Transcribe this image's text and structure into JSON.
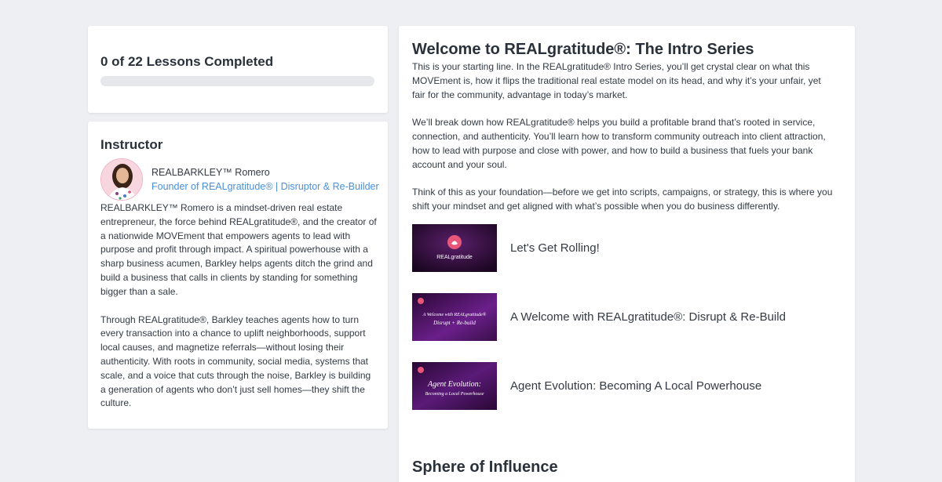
{
  "progress": {
    "label": "0 of 22 Lessons Completed",
    "completed": 0,
    "total": 22
  },
  "instructor": {
    "heading": "Instructor",
    "name": "REALBARKLEY™ Romero",
    "role": "Founder of REALgratitude® | Disruptor & Re-Builder",
    "bio": [
      "REALBARKLEY™ Romero is a mindset-driven real estate entrepreneur, the force behind REALgratitude®, and the creator of a nationwide MOVEment that empowers agents to lead with purpose and profit through impact. A spiritual powerhouse with a sharp business acumen, Barkley helps agents ditch the grind and build a business that calls in clients by standing for something bigger than a sale.",
      "Through REALgratitude®, Barkley teaches agents how to turn every transaction into a chance to uplift neighborhoods, support local causes, and magnetize referrals—without losing their authenticity. With roots in community, social media, systems that scale, and a voice that cuts through the noise, Barkley is building a generation of agents who don’t just sell homes—they shift the culture."
    ]
  },
  "course": {
    "title": "Welcome to REALgratitude®: The Intro Series",
    "paragraphs": [
      "This is your starting line. In the REALgratitude® Intro Series, you’ll get crystal clear on what this MOVEment is, how it flips the traditional real estate model on its head, and why it’s your unfair, yet fair for the community, advantage in today’s market.",
      "We’ll break down how REALgratitude® helps you build a profitable brand that’s rooted in service, connection, and authenticity. You’ll learn how to transform community outreach into client attraction, how to lead with purpose and close with power, and how to build a business that fuels your bank account and your soul.",
      "Think of this as your foundation—before we get into scripts, campaigns, or strategy, this is where you shift your mindset and get aligned with what’s possible when you do business differently."
    ],
    "lessons": [
      {
        "title": "Let's Get Rolling!",
        "thumb_text": "REALgratitude",
        "thumb_text_sub": ""
      },
      {
        "title": "A Welcome with REALgratitude®: Disrupt & Re-Build",
        "thumb_text": "A Welcome with REALgratitude®",
        "thumb_text_sub": "Disrupt + Re-build"
      },
      {
        "title": "Agent Evolution: Becoming A Local Powerhouse",
        "thumb_text": "Agent Evolution:",
        "thumb_text_sub": "Becoming a Local Powerhouse"
      }
    ],
    "next_section_title": "Sphere of Influence"
  },
  "colors": {
    "background": "#eeeff2",
    "link": "#4a90d9",
    "thumb_purple": "#3a0f4a",
    "thumb_pink": "#e8567a"
  }
}
